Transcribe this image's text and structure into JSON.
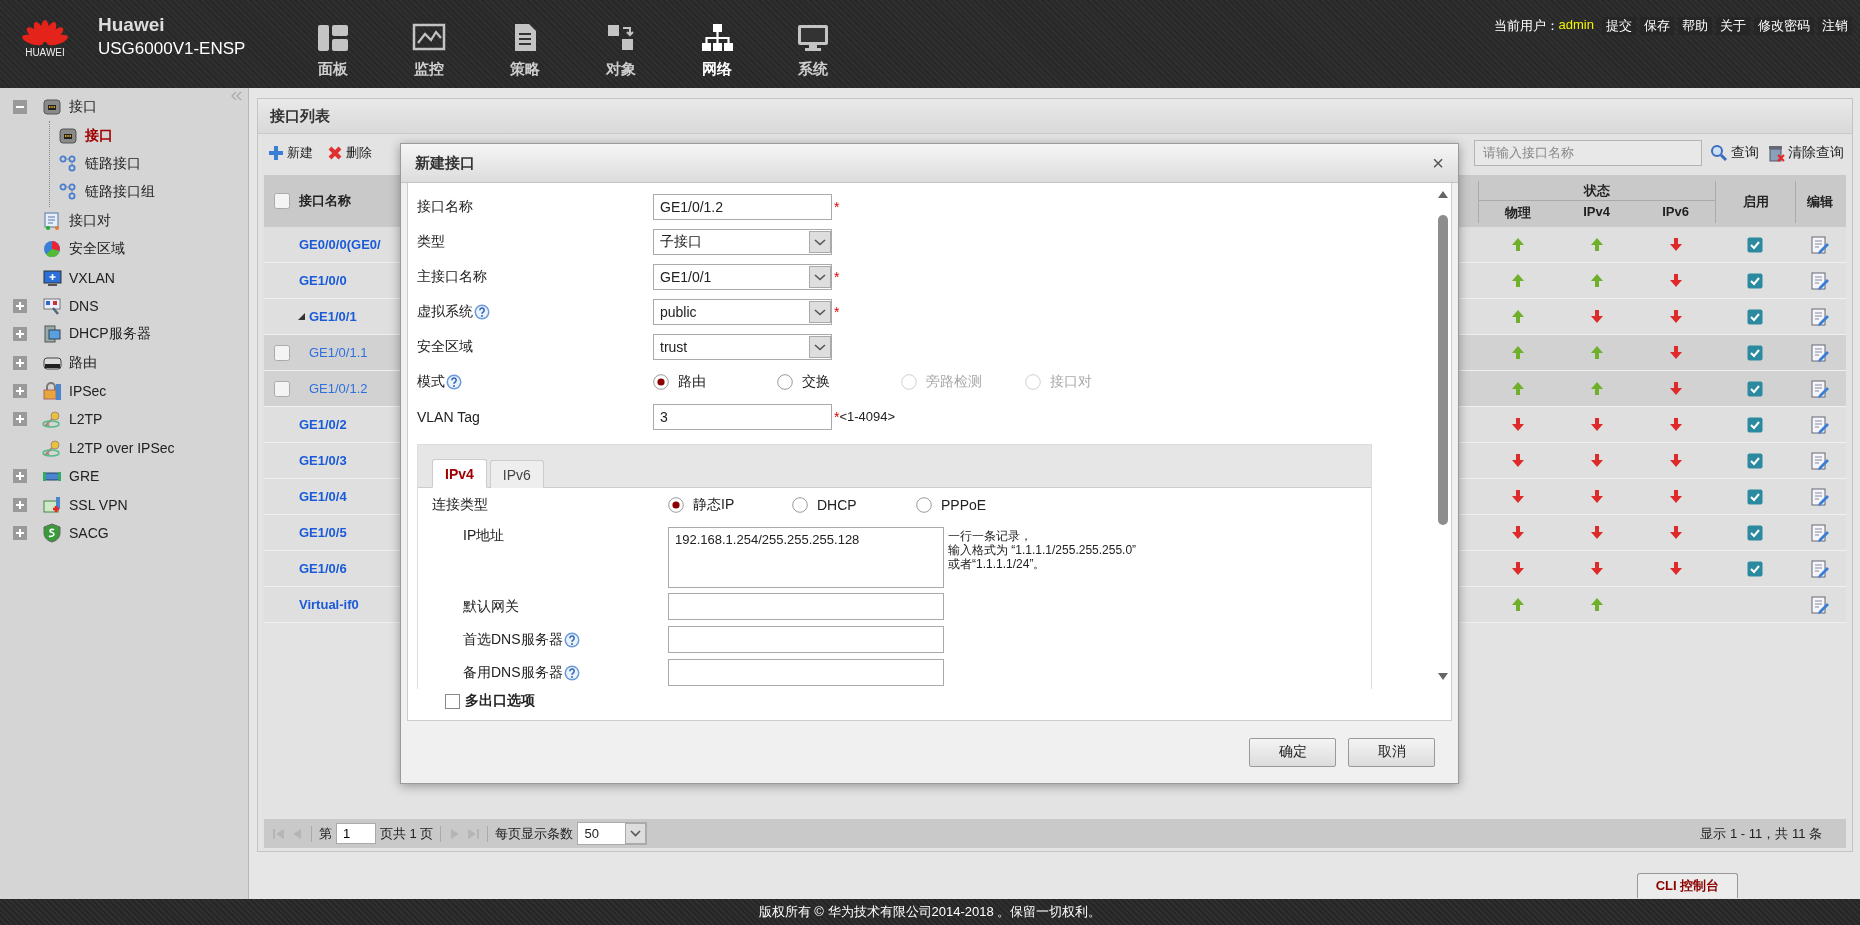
{
  "header": {
    "logo_text": "HUAWEI",
    "brand": "Huawei",
    "model": "USG6000V1-ENSP",
    "nav": [
      {
        "label": "面板",
        "selected": false
      },
      {
        "label": "监控",
        "selected": false
      },
      {
        "label": "策略",
        "selected": false
      },
      {
        "label": "对象",
        "selected": false
      },
      {
        "label": "网络",
        "selected": true
      },
      {
        "label": "系统",
        "selected": false
      }
    ],
    "user_label": "当前用户：",
    "user": "admin",
    "links": [
      "提交",
      "保存",
      "帮助",
      "关于",
      "修改密码",
      "注销"
    ]
  },
  "sidebar": {
    "items": [
      {
        "label": "接口",
        "kind": "group",
        "expanded": true,
        "selected": false,
        "children": [
          {
            "label": "接口",
            "selected": true
          },
          {
            "label": "链路接口",
            "selected": false
          },
          {
            "label": "链路接口组",
            "selected": false
          }
        ]
      },
      {
        "label": "接口对",
        "kind": "leaf",
        "selected": false
      },
      {
        "label": "安全区域",
        "kind": "leaf",
        "selected": false
      },
      {
        "label": "VXLAN",
        "kind": "leaf",
        "selected": false
      },
      {
        "label": "DNS",
        "kind": "group",
        "expanded": false,
        "selected": false
      },
      {
        "label": "DHCP服务器",
        "kind": "group",
        "expanded": false,
        "selected": false
      },
      {
        "label": "路由",
        "kind": "group",
        "expanded": false,
        "selected": false
      },
      {
        "label": "IPSec",
        "kind": "group",
        "expanded": false,
        "selected": false
      },
      {
        "label": "L2TP",
        "kind": "group",
        "expanded": false,
        "selected": false
      },
      {
        "label": "L2TP over IPSec",
        "kind": "leaf",
        "selected": false
      },
      {
        "label": "GRE",
        "kind": "group",
        "expanded": false,
        "selected": false
      },
      {
        "label": "SSL VPN",
        "kind": "group",
        "expanded": false,
        "selected": false
      },
      {
        "label": "SACG",
        "kind": "group",
        "expanded": false,
        "selected": false
      }
    ]
  },
  "panel": {
    "title": "接口列表",
    "actions": [
      "新建",
      "删除"
    ],
    "search": {
      "placeholder": "请输入接口名称"
    },
    "search_buttons": [
      "查询",
      "清除查询"
    ],
    "table": {
      "select_all": false,
      "columns": {
        "name": "接口名称",
        "status": "状态",
        "physical": "物理",
        "ipv4": "IPv4",
        "ipv6": "IPv6",
        "enabled": "启用",
        "edit": "编辑"
      },
      "rows": [
        {
          "name": "GE0/0/0(GE0/",
          "physical_up": true,
          "ipv4_up": true,
          "ipv6_up": false,
          "enabled": true
        },
        {
          "name": "GE1/0/0",
          "physical_up": true,
          "ipv4_up": true,
          "ipv6_up": false,
          "enabled": true
        },
        {
          "name": "GE1/0/1",
          "expanded": true,
          "physical_up": true,
          "ipv4_up": false,
          "ipv6_up": false,
          "enabled": true,
          "children": [
            {
              "name": "GE1/0/1.1",
              "checked": false,
              "physical_up": true,
              "ipv4_up": true,
              "ipv6_up": false,
              "enabled": true
            },
            {
              "name": "GE1/0/1.2",
              "checked": false,
              "physical_up": true,
              "ipv4_up": true,
              "ipv6_up": false,
              "enabled": true
            }
          ]
        },
        {
          "name": "GE1/0/2",
          "physical_up": false,
          "ipv4_up": false,
          "ipv6_up": false,
          "enabled": true
        },
        {
          "name": "GE1/0/3",
          "physical_up": false,
          "ipv4_up": false,
          "ipv6_up": false,
          "enabled": true
        },
        {
          "name": "GE1/0/4",
          "physical_up": false,
          "ipv4_up": false,
          "ipv6_up": false,
          "enabled": true
        },
        {
          "name": "GE1/0/5",
          "physical_up": false,
          "ipv4_up": false,
          "ipv6_up": false,
          "enabled": true
        },
        {
          "name": "GE1/0/6",
          "physical_up": false,
          "ipv4_up": false,
          "ipv6_up": false,
          "enabled": true
        },
        {
          "name": "Virtual-if0",
          "physical_up": true,
          "ipv4_up": true,
          "enabled": false
        }
      ]
    }
  },
  "pagination": {
    "page_label": "第",
    "page": "1",
    "page_total": "页共 1 页",
    "per_page_label": "每页显示条数",
    "per_page": "50",
    "summary": "显示 1 - 11，共 11 条"
  },
  "cli_tab": "CLI 控制台",
  "footer": "版权所有 © 华为技术有限公司2014-2018 。保留一切权利。",
  "modal": {
    "title": "新建接口",
    "close": "×",
    "fields": [
      {
        "kind": "text",
        "label": "接口名称",
        "help": false,
        "value": "GE1/0/1.2",
        "mark": "*"
      },
      {
        "kind": "select",
        "label": "类型",
        "help": false,
        "value": "子接口"
      },
      {
        "kind": "select",
        "label": "主接口名称",
        "help": false,
        "value": "GE1/0/1",
        "mark": "*"
      },
      {
        "kind": "select",
        "label": "虚拟系统",
        "help": true,
        "value": "public",
        "mark": "*"
      },
      {
        "kind": "select",
        "label": "安全区域",
        "help": false,
        "value": "trust"
      },
      {
        "kind": "radio",
        "label": "模式",
        "help": true,
        "options": [
          {
            "label": "路由",
            "selected": true,
            "disabled": false
          },
          {
            "label": "交换",
            "selected": false,
            "disabled": false
          },
          {
            "label": "旁路检测",
            "selected": false,
            "disabled": true
          },
          {
            "label": "接口对",
            "selected": false,
            "disabled": true
          }
        ]
      },
      {
        "kind": "text",
        "label": "VLAN Tag",
        "help": false,
        "value": "3",
        "mark": "*",
        "hint": "<1-4094>"
      }
    ],
    "tabs": [
      {
        "label": "IPv4",
        "selected": true
      },
      {
        "label": "IPv6",
        "selected": false
      }
    ],
    "ipv4_fields": [
      {
        "kind": "radio",
        "label": "连接类型",
        "help": false,
        "options": [
          {
            "label": "静态IP",
            "selected": true,
            "disabled": false
          },
          {
            "label": "DHCP",
            "selected": false,
            "disabled": false
          },
          {
            "label": "PPPoE",
            "selected": false,
            "disabled": false
          }
        ]
      },
      {
        "kind": "textarea",
        "label": "IP地址",
        "help": false,
        "value": "192.168.1.254/255.255.255.128",
        "note": [
          "一行一条记录，",
          "输入格式为 “1.1.1.1/255.255.255.0”",
          "或者“1.1.1.1/24”。"
        ]
      },
      {
        "kind": "text",
        "label": "默认网关",
        "help": false
      },
      {
        "kind": "text",
        "label": "首选DNS服务器",
        "help": true
      },
      {
        "kind": "text",
        "label": "备用DNS服务器",
        "help": true
      }
    ],
    "option": {
      "label": "多出口选项",
      "checked": false
    },
    "buttons": [
      "确定",
      "取消"
    ]
  }
}
